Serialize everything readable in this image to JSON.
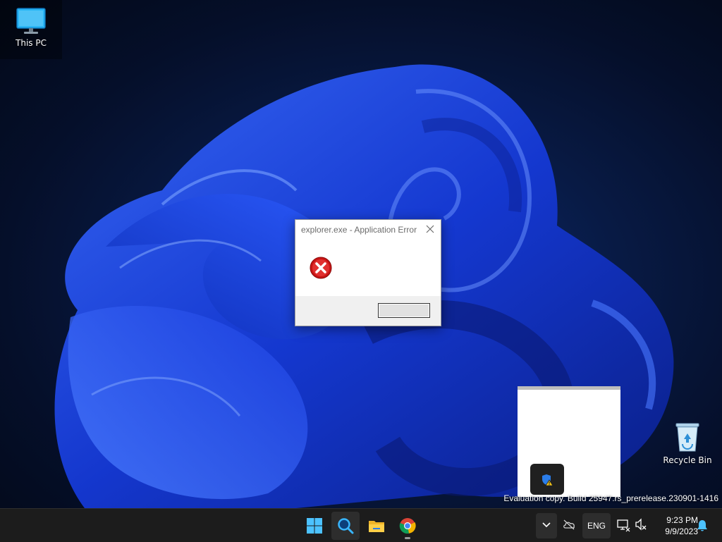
{
  "desktop": {
    "icons": [
      {
        "label": "This PC",
        "icon": "monitor-icon"
      },
      {
        "label": "Recycle Bin",
        "icon": "recycle-bin-icon"
      }
    ],
    "watermark": "Evaluation copy. Build 25947.rs_prerelease.230901-1416"
  },
  "error_dialog": {
    "title": "explorer.exe - Application Error",
    "icon": "error-x-icon",
    "ok_label": ""
  },
  "taskbar": {
    "apps": [
      {
        "name": "Start",
        "icon": "windows-logo-icon"
      },
      {
        "name": "Search",
        "icon": "search-icon"
      },
      {
        "name": "File Explorer",
        "icon": "folder-icon"
      },
      {
        "name": "Google Chrome",
        "icon": "chrome-icon"
      }
    ],
    "tray": {
      "language": "ENG",
      "time": "9:23 PM",
      "date": "9/9/2023"
    }
  },
  "colors": {
    "accent": "#1f6fff",
    "taskbar_bg": "#1c1c1c",
    "error_red": "#d81e1e"
  }
}
